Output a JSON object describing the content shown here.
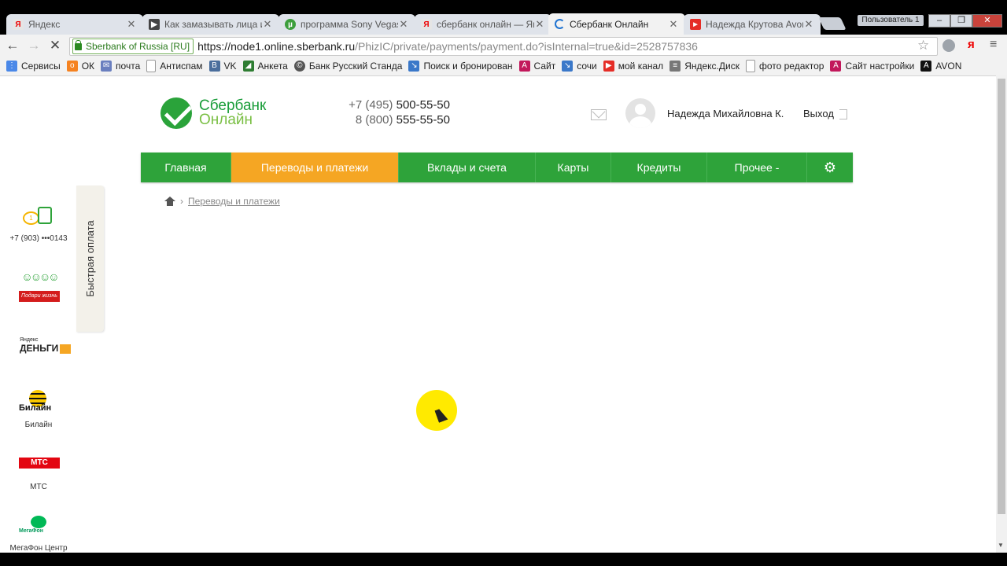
{
  "browser": {
    "tabs": [
      {
        "title": "Яндекс",
        "favicon": "yandex-icon",
        "favicon_color": "#e5e5e5"
      },
      {
        "title": "Как замазывать лица и",
        "favicon": "play-icon",
        "favicon_color": "#444444"
      },
      {
        "title": "программа Sony Vegas",
        "favicon": "utorrent-icon",
        "favicon_color": "#3c9e3c"
      },
      {
        "title": "сбербанк онлайн — Ян",
        "favicon": "yandex-icon",
        "favicon_color": "#e5e5e5"
      },
      {
        "title": "Сбербанк Онлайн",
        "favicon": "loading-icon",
        "favicon_color": "#1f73d1",
        "active": true
      },
      {
        "title": "Надежда Крутова Avon",
        "favicon": "youtube-icon",
        "favicon_color": "#e52d27"
      }
    ],
    "user_badge": "Пользователь 1",
    "window_controls": [
      "–",
      "❐",
      "✕"
    ],
    "address": {
      "ev_label": "Sberbank of Russia [RU]",
      "scheme": "https://",
      "host": "node1.online.sberbank.ru",
      "path": "/PhizIC/private/payments/payment.do?isInternal=true&id=2528757836"
    },
    "bookmarks": [
      {
        "label": "Сервисы",
        "icon": "apps-icon",
        "color": "#4a88e8"
      },
      {
        "label": "ОК",
        "icon": "ok-icon",
        "color": "#f58220"
      },
      {
        "label": "почта",
        "icon": "mail-icon",
        "color": "#6a7fbf"
      },
      {
        "label": "Антиспам",
        "icon": "page-icon",
        "color": "#999999"
      },
      {
        "label": "VK",
        "icon": "vk-icon",
        "color": "#4a6e9c"
      },
      {
        "label": "Анкета",
        "icon": "chart-icon",
        "color": "#2e7d32"
      },
      {
        "label": "Банк Русский Станда",
        "icon": "bank-icon",
        "color": "#555555"
      },
      {
        "label": "Поиск и бронирован",
        "icon": "pin-icon",
        "color": "#3a78c9"
      },
      {
        "label": "Сайт",
        "icon": "avon-a-icon",
        "color": "#c2185b"
      },
      {
        "label": "сочи",
        "icon": "pin-icon",
        "color": "#3a78c9"
      },
      {
        "label": "мой канал",
        "icon": "youtube-icon",
        "color": "#e52d27"
      },
      {
        "label": "Яндекс.Диск",
        "icon": "disk-icon",
        "color": "#777777"
      },
      {
        "label": "фото редактор",
        "icon": "page-icon",
        "color": "#999999"
      },
      {
        "label": "Сайт настройки",
        "icon": "avon-a-icon",
        "color": "#c2185b"
      },
      {
        "label": "AVON",
        "icon": "avon-icon",
        "color": "#111111"
      }
    ]
  },
  "header": {
    "logo_line1": "Сбербанк",
    "logo_line2": "Онлайн",
    "phone1_prefix": "+7 (495)",
    "phone1_number": "500-55-50",
    "phone2_prefix": "8 (800)",
    "phone2_number": "555-55-50",
    "user_name": "Надежда Михайловна К.",
    "logout_label": "Выход"
  },
  "nav": {
    "items": [
      "Главная",
      "Переводы и платежи",
      "Вклады и счета",
      "Карты",
      "Кредиты",
      "Прочее -"
    ],
    "active_index": 1,
    "accent": "#2ea33a",
    "active_color": "#f5a623"
  },
  "breadcrumb": {
    "current": "Переводы и платежи"
  },
  "quick_pay": {
    "tab_label": "Быстрая оплата",
    "items": [
      {
        "label": "+7 (903) •••0143",
        "icon": "phone-payment-icon"
      },
      {
        "label": "",
        "icon": "charity-icon",
        "logo_text": "Подари жизнь"
      },
      {
        "label": "",
        "icon": "yandex-money-icon",
        "logo_text_small": "Яндекс",
        "logo_text": "ДЕНЬГИ"
      },
      {
        "label": "Билайн",
        "icon": "beeline-icon",
        "logo_text": "Билайн"
      },
      {
        "label": "МТС",
        "icon": "mts-icon",
        "logo_text": "МТС"
      },
      {
        "label": "МегаФон Центр",
        "icon": "megafon-icon",
        "logo_text": "МегаФон"
      }
    ]
  }
}
